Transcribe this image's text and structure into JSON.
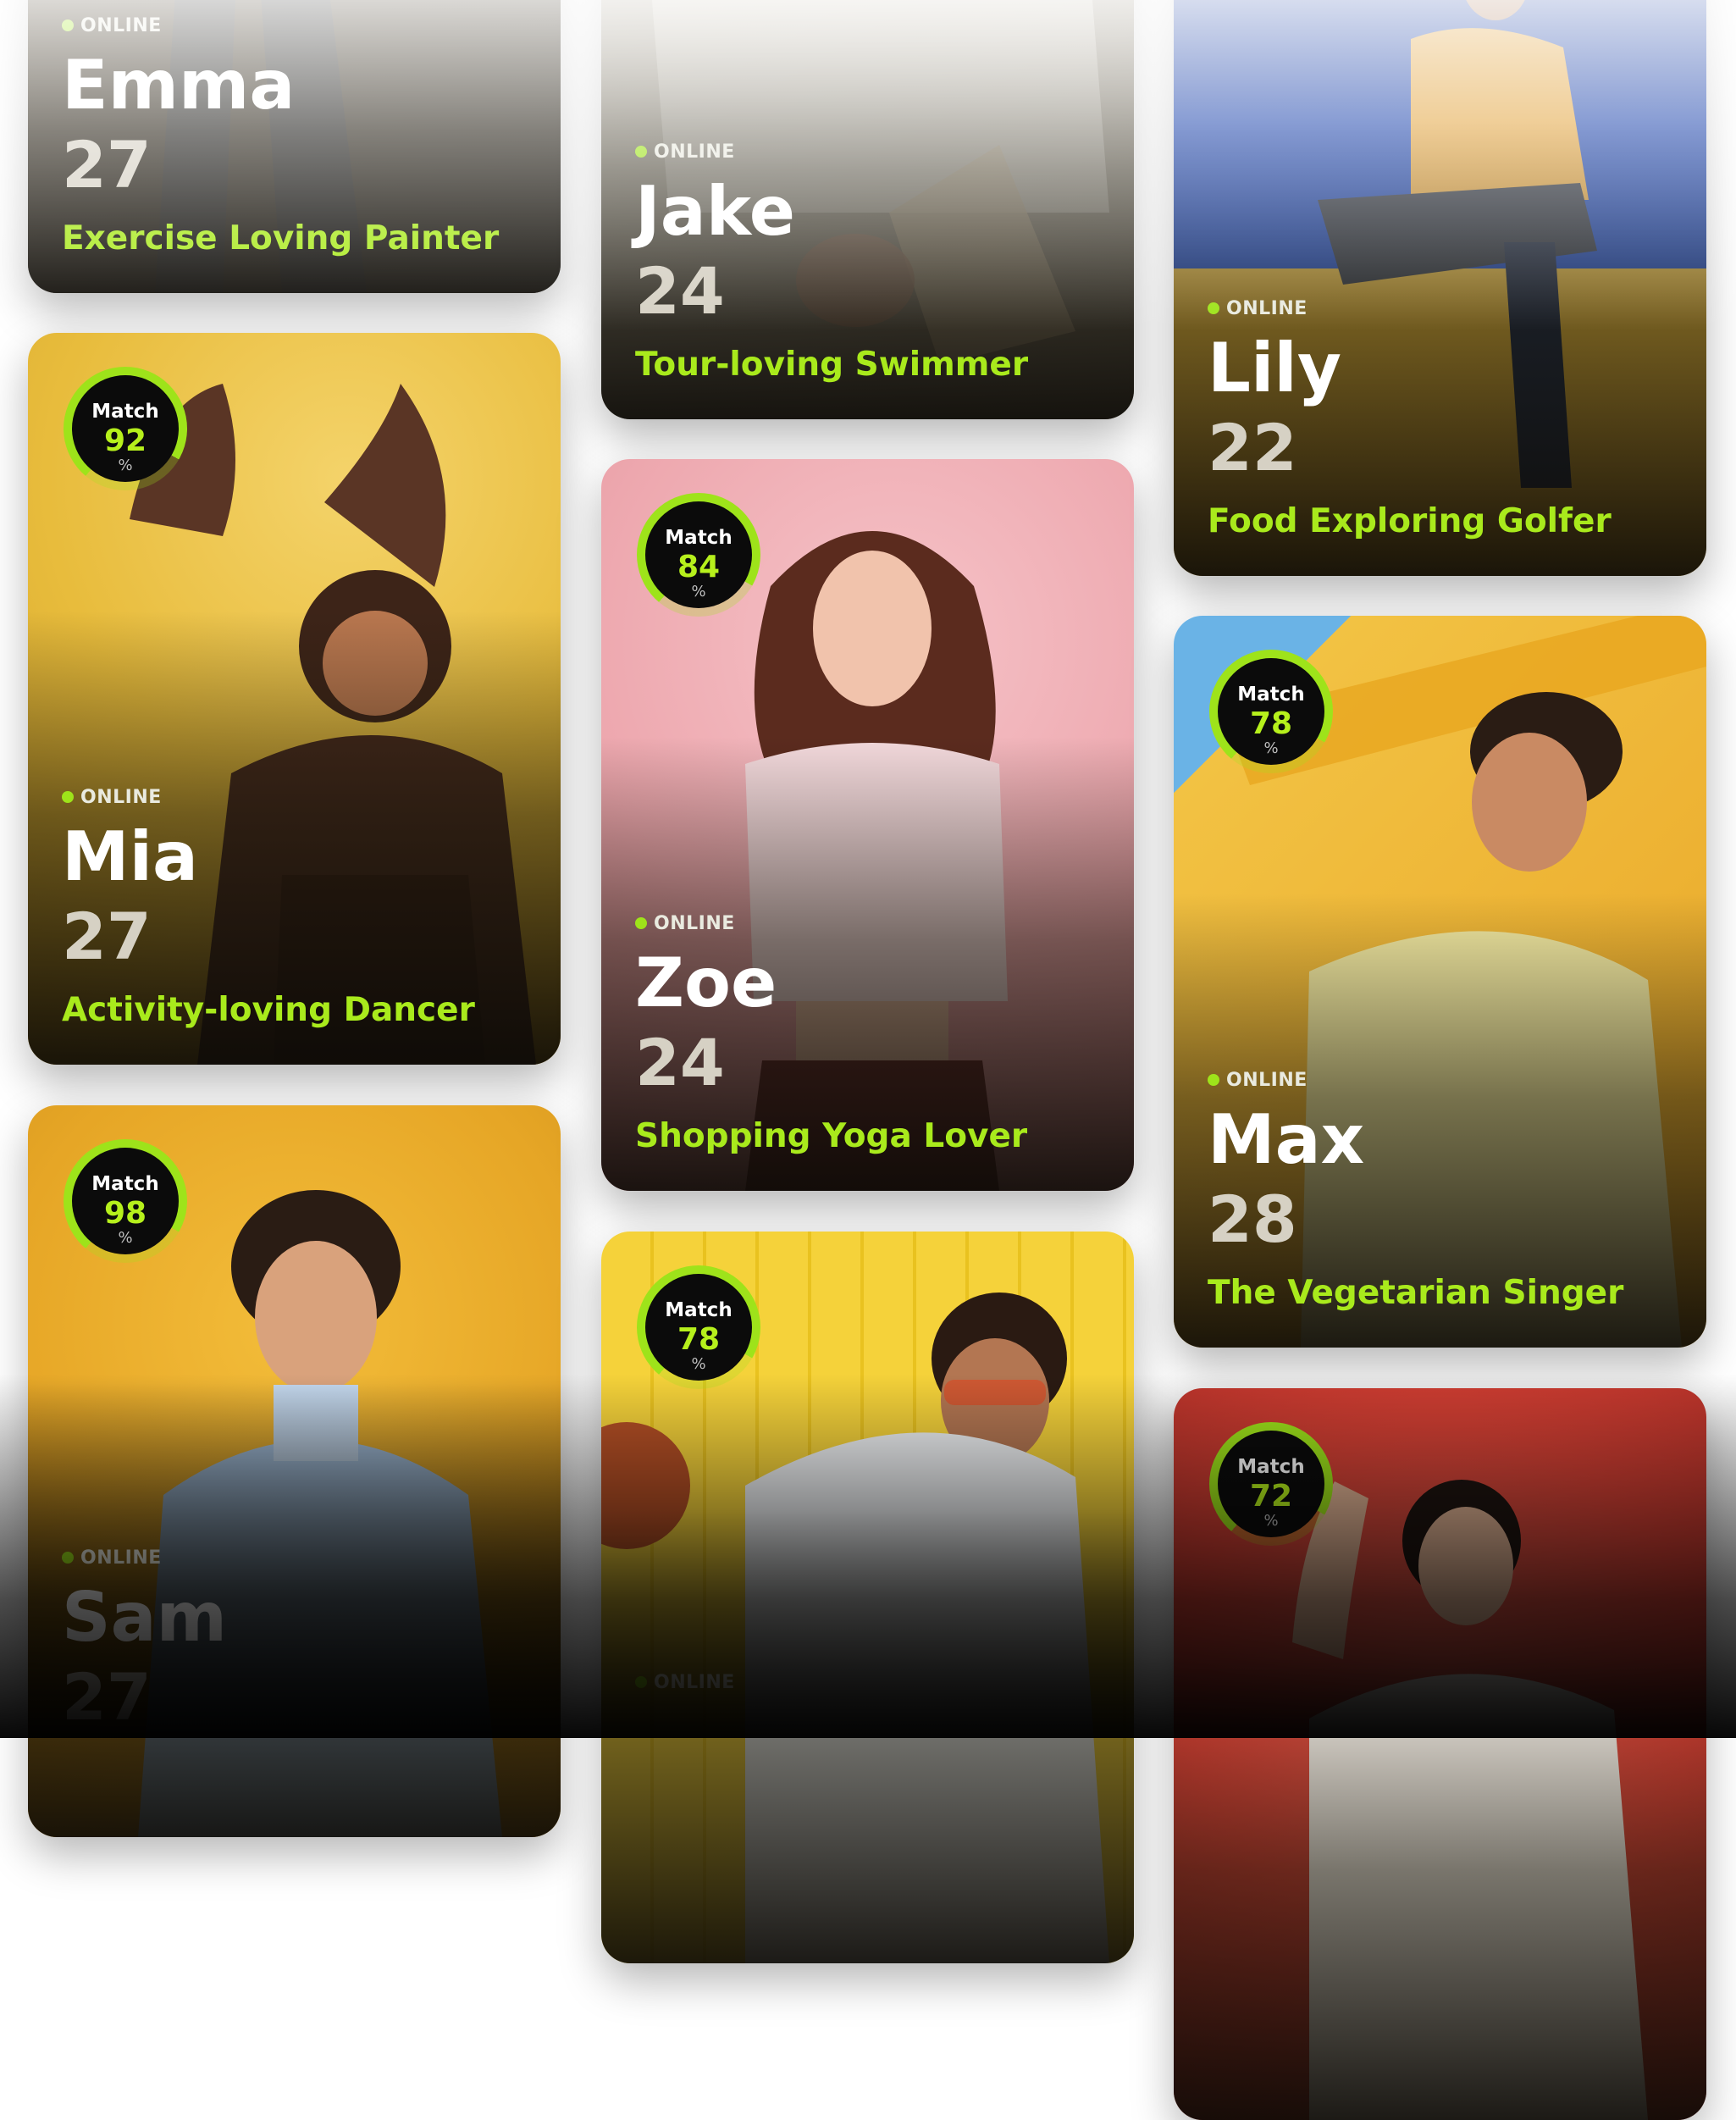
{
  "status_label": "ONLINE",
  "match_label": "Match",
  "percent_unit": "%",
  "colors": {
    "accent": "#9ee31a",
    "tagline": "#a9ea1c",
    "age": "#d6d1c4",
    "badge_bg": "#0b0b0b"
  },
  "profiles": {
    "emma": {
      "name": "Emma",
      "age": "27",
      "tagline": "Exercise Loving Painter",
      "status": "ONLINE"
    },
    "jake": {
      "name": "Jake",
      "age": "24",
      "tagline": "Tour-loving Swimmer",
      "status": "ONLINE"
    },
    "lily": {
      "name": "Lily",
      "age": "22",
      "tagline": "Food Exploring Golfer",
      "status": "ONLINE"
    },
    "mia": {
      "name": "Mia",
      "age": "27",
      "tagline": "Activity-loving Dancer",
      "status": "ONLINE",
      "match": "92",
      "match_fraction": 0.92
    },
    "zoe": {
      "name": "Zoe",
      "age": "24",
      "tagline": "Shopping Yoga Lover",
      "status": "ONLINE",
      "match": "84",
      "match_fraction": 0.84
    },
    "max": {
      "name": "Max",
      "age": "28",
      "tagline": "The Vegetarian Singer",
      "status": "ONLINE",
      "match": "78",
      "match_fraction": 0.78
    },
    "sam": {
      "name": "Sam",
      "age": "27",
      "status": "ONLINE",
      "match": "98",
      "match_fraction": 0.98
    },
    "basketball_player": {
      "status": "ONLINE",
      "match": "78",
      "match_fraction": 0.78
    },
    "red_card": {
      "match": "72",
      "match_fraction": 0.72
    }
  }
}
